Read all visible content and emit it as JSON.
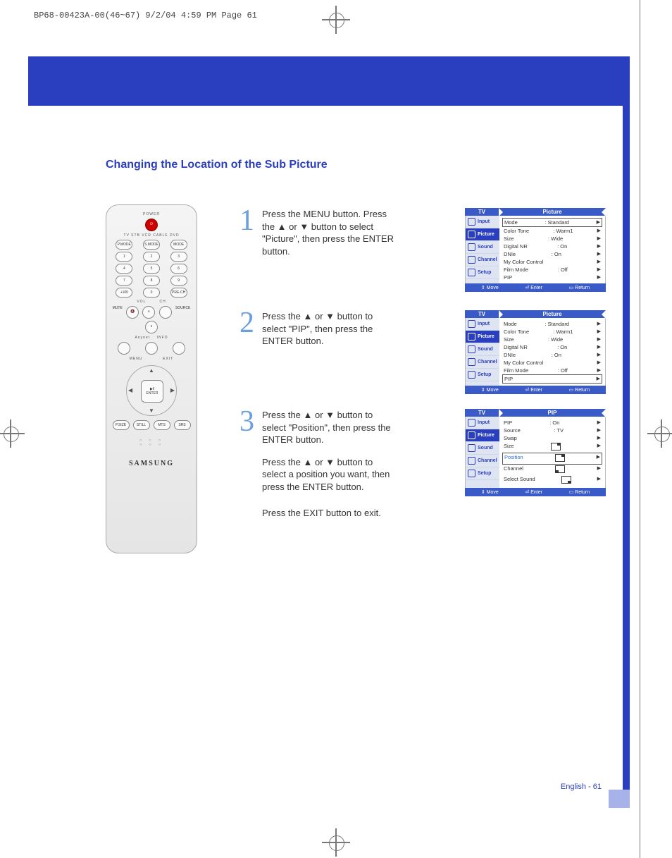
{
  "print_header": "BP68-00423A-00(46~67)  9/2/04  4:59 PM  Page 61",
  "title": "Changing the Location of the Sub Picture",
  "remote": {
    "power_label": "POWER",
    "device_row": "TV  STB  VCR  CABLE  DVD",
    "mode_labels": [
      "P.MODE",
      "S.MODE",
      "MODE"
    ],
    "numpad": [
      [
        "1",
        "2",
        "3"
      ],
      [
        "4",
        "5",
        "6"
      ],
      [
        "7",
        "8",
        "9"
      ],
      [
        "+100",
        "0",
        "PRE-CH"
      ]
    ],
    "vol_ch": {
      "vol": "VOL",
      "ch": "CH",
      "mute": "MUTE",
      "source": "SOURCE"
    },
    "mid_labels": [
      "Anynet",
      "INFO",
      "MENU",
      "EXIT"
    ],
    "dpad_center": [
      "▶ǁ",
      "ENTER"
    ],
    "bottom_labels": [
      "P.SIZE",
      "STILL",
      "MTS",
      "SRS"
    ],
    "brand": "SAMSUNG"
  },
  "steps": [
    {
      "num": "1",
      "text": "Press the MENU button. Press the ▲ or ▼ button to select \"Picture\", then press the ENTER button.",
      "osd": {
        "tv": "TV",
        "banner": "Picture",
        "side": [
          "Input",
          "Picture",
          "Sound",
          "Channel",
          "Setup"
        ],
        "active": 1,
        "rows": [
          {
            "l": "Mode",
            "v": ": Standard",
            "boxed": true
          },
          {
            "l": "Color Tone",
            "v": ": Warm1"
          },
          {
            "l": "Size",
            "v": ": Wide"
          },
          {
            "l": "Digital NR",
            "v": ": On"
          },
          {
            "l": "DNIe",
            "v": ": On"
          },
          {
            "l": "My Color Control",
            "v": ""
          },
          {
            "l": "Film Mode",
            "v": ": Off"
          },
          {
            "l": "PIP",
            "v": ""
          }
        ],
        "foot": [
          "⇕ Move",
          "⏎ Enter",
          "▭ Return"
        ]
      }
    },
    {
      "num": "2",
      "text": "Press the ▲ or ▼ button to select \"PIP\", then press the ENTER button.",
      "osd": {
        "tv": "TV",
        "banner": "Picture",
        "side": [
          "Input",
          "Picture",
          "Sound",
          "Channel",
          "Setup"
        ],
        "active": 1,
        "rows": [
          {
            "l": "Mode",
            "v": ": Standard"
          },
          {
            "l": "Color Tone",
            "v": ": Warm1"
          },
          {
            "l": "Size",
            "v": ": Wide"
          },
          {
            "l": "Digital NR",
            "v": ": On"
          },
          {
            "l": "DNIe",
            "v": ": On"
          },
          {
            "l": "My Color Control",
            "v": ""
          },
          {
            "l": "Film Mode",
            "v": ": Off"
          },
          {
            "l": "PIP",
            "v": "",
            "boxed": true
          }
        ],
        "foot": [
          "⇕ Move",
          "⏎ Enter",
          "▭ Return"
        ]
      }
    },
    {
      "num": "3",
      "text": "Press the ▲ or ▼ button to select \"Position\", then press the ENTER button.",
      "text2": "Press the ▲ or ▼ button to select a position you want, then press the ENTER button.",
      "text3": "Press the EXIT button to exit.",
      "osd": {
        "tv": "TV",
        "banner": "PIP",
        "side": [
          "Input",
          "Picture",
          "Sound",
          "Channel",
          "Setup"
        ],
        "active": 1,
        "rows": [
          {
            "l": "PIP",
            "v": ": On"
          },
          {
            "l": "Source",
            "v": ": TV"
          },
          {
            "l": "Swap",
            "v": ""
          },
          {
            "l": "Size",
            "v": "",
            "icon": "tr"
          },
          {
            "l": "Position",
            "v": "",
            "icon": "tr",
            "selected": true,
            "boxed": true
          },
          {
            "l": "Channel",
            "v": "",
            "icon": "bl"
          },
          {
            "l": "Select Sound",
            "v": "",
            "icon": "br"
          }
        ],
        "foot": [
          "⇕ Move",
          "⏎ Enter",
          "▭ Return"
        ]
      }
    }
  ],
  "footer": "English - 61"
}
